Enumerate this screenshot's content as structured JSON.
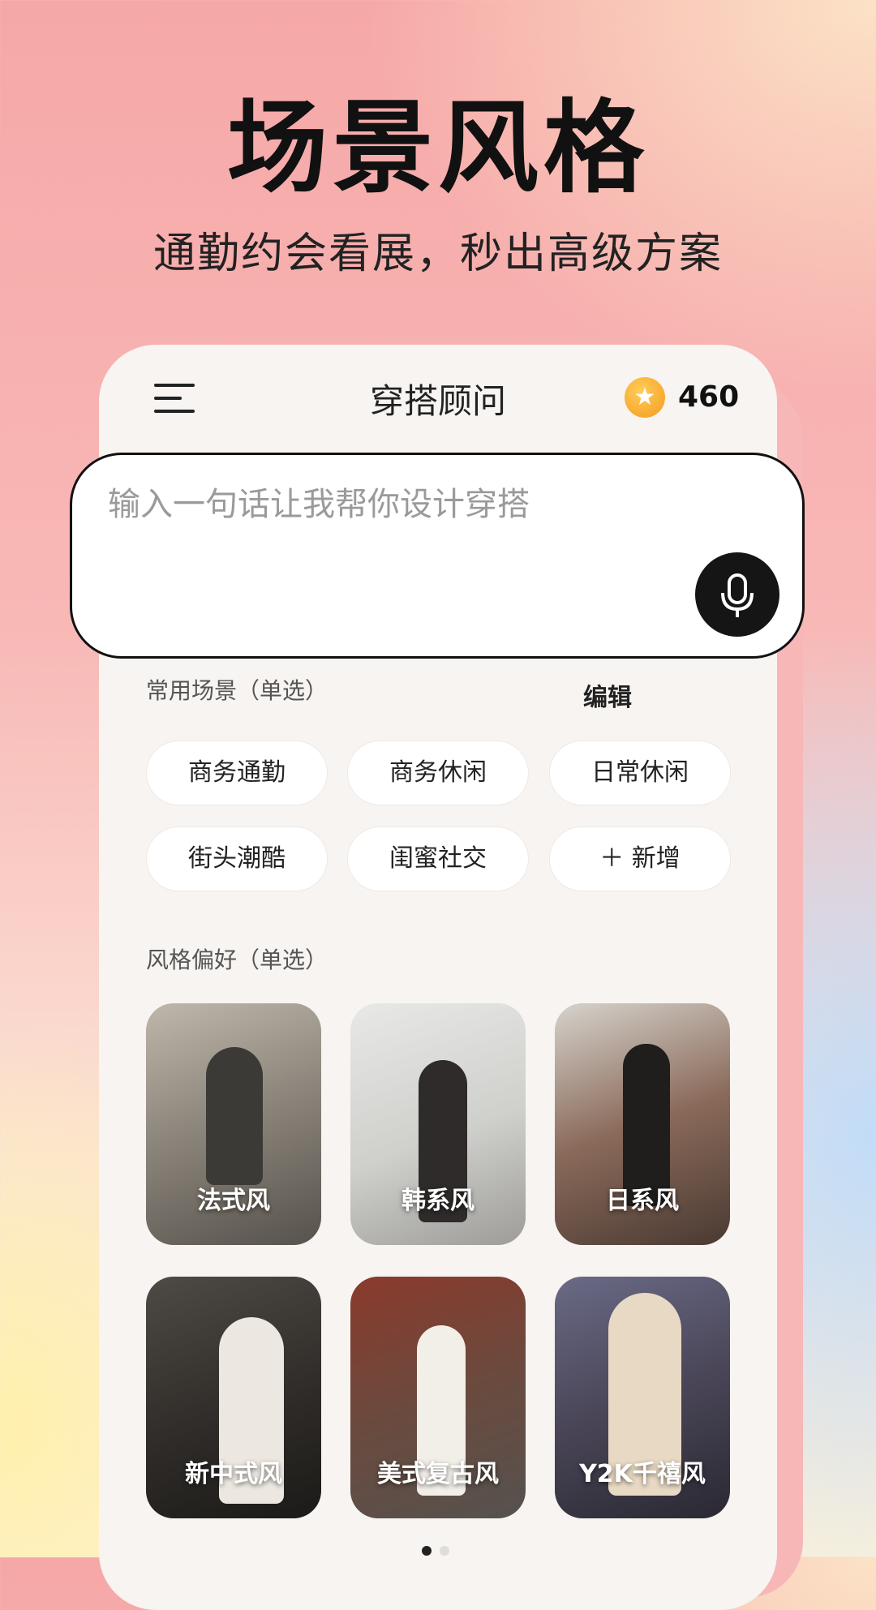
{
  "hero": {
    "title": "场景风格",
    "subtitle": "通勤约会看展，秒出高级方案"
  },
  "header": {
    "menu_icon": "hamburger-menu-icon",
    "title": "穿搭顾问",
    "coin_icon": "star-coin-icon",
    "coin_count": "460"
  },
  "prompt": {
    "placeholder": "输入一句话让我帮你设计穿搭",
    "mic_icon": "microphone-icon"
  },
  "scenes": {
    "label": "常用场景（单选）",
    "edit_label": "编辑",
    "chips": [
      "商务通勤",
      "商务休闲",
      "日常休闲",
      "街头潮酷",
      "闺蜜社交",
      "＋ 新增"
    ]
  },
  "styles": {
    "label": "风格偏好（单选）",
    "cards": [
      "法式风",
      "韩系风",
      "日系风",
      "新中式风",
      "美式复古风",
      "Y2K千禧风"
    ]
  },
  "pagination": {
    "pages": 2,
    "current": 1,
    "active_color": "#222222",
    "inactive_color": "#dddddd"
  },
  "colors": {
    "accent_card_shadow": "#f7b7b7",
    "card_background": "#f7f4f1",
    "coin": "#f5a623",
    "mic_button": "#151515"
  }
}
